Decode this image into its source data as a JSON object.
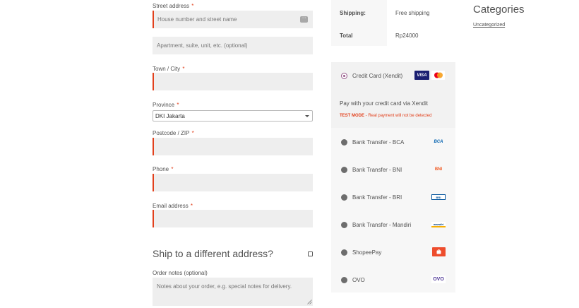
{
  "billing": {
    "street_label": "Street address",
    "street_placeholder": "House number and street name",
    "apartment_placeholder": "Apartment, suite, unit, etc. (optional)",
    "city_label": "Town / City",
    "province_label": "Province",
    "province_value": "DKI Jakarta",
    "postcode_label": "Postcode / ZIP",
    "phone_label": "Phone",
    "email_label": "Email address",
    "required_mark": "*",
    "ship_different_label": "Ship to a different address?",
    "order_notes_label": "Order notes (optional)",
    "order_notes_placeholder": "Notes about your order, e.g. special notes for delivery."
  },
  "totals": {
    "shipping_label": "Shipping:",
    "shipping_value": "Free shipping",
    "total_label": "Total",
    "total_value": "Rp24000"
  },
  "payment": {
    "selected": "credit-card",
    "credit_card_label": "Credit Card (Xendit)",
    "visa_text": "VISA",
    "description": "Pay with your credit card via Xendit",
    "test_mode_label": "TEST MODE",
    "test_mode_text": " - Real payment will not be detected",
    "methods": [
      {
        "label": "Bank Transfer - BCA",
        "logo": "BCA"
      },
      {
        "label": "Bank Transfer - BNI",
        "logo": "BNI"
      },
      {
        "label": "Bank Transfer - BRI",
        "logo": "BRI"
      },
      {
        "label": "Bank Transfer - Mandiri",
        "logo": "mandiri"
      },
      {
        "label": "ShopeePay",
        "logo": "shopeepay-icon"
      },
      {
        "label": "OVO",
        "logo": "OVO"
      }
    ]
  },
  "sidebar": {
    "categories_title": "Categories",
    "categories": [
      "Uncategorized"
    ]
  },
  "colors": {
    "required": "#e2401c",
    "radio_selected": "#96588a",
    "visa": "#1a1f71",
    "bca": "#0060af",
    "bni": "#f15a23",
    "shopeepay": "#ee4d2d",
    "ovo": "#4c3494"
  }
}
